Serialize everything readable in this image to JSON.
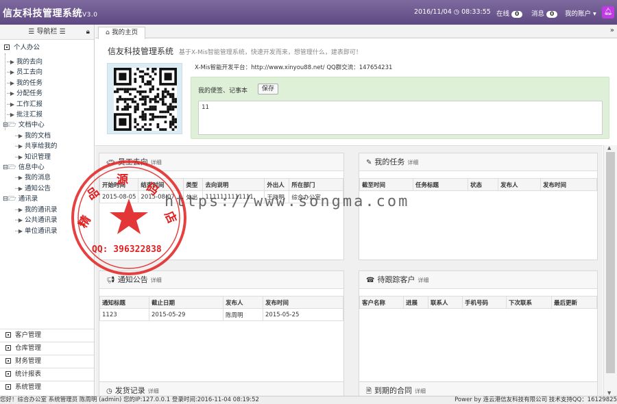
{
  "header": {
    "title": "信友科技管理系统",
    "version": "V3.0",
    "datetime": "2016/11/04",
    "time": "08:33:55",
    "online_label": "在线",
    "online_count": "0",
    "msg_label": "消息",
    "msg_count": "0",
    "account_label": "我的账户"
  },
  "sidebar": {
    "title": "导航栏",
    "top_group": "个人办公",
    "items": [
      "我的去向",
      "员工去向",
      "我的任务",
      "分配任务",
      "工作汇报",
      "批注汇报"
    ],
    "doc_group": "文档中心",
    "doc_items": [
      "我的文档",
      "共享给我的",
      "知识管理"
    ],
    "info_group": "信息中心",
    "info_items": [
      "我的消息",
      "通知公告"
    ],
    "contact_group": "通讯录",
    "contact_items": [
      "我的通讯录",
      "公共通讯录",
      "单位通讯录"
    ],
    "bottom": [
      "客户管理",
      "仓库管理",
      "财务管理",
      "统计报表",
      "系统管理"
    ]
  },
  "tabs": {
    "home": "我的主页"
  },
  "welcome": {
    "title": "信友科技管理系统",
    "subtitle": "基于X-Mis智能管理系统，快速开发而来，想管理什么，建表即可！",
    "dev_line": "X-Mis智能开发平台：http://www.xinyou88.net/ QQ群交流：147654231",
    "notebook_label": "我的便签、记事本",
    "save_label": "保存",
    "notebook_value": "11"
  },
  "panels": {
    "staff": {
      "title": "员工去向",
      "more": "详细",
      "columns": [
        "开始时间",
        "结束时间",
        "类型",
        "去向说明",
        "外出人",
        "所在部门"
      ],
      "rows": [
        [
          "2015-08-05",
          "2015-08-07",
          "外出",
          "1111111111111",
          "王晓明",
          "综合办公室"
        ]
      ]
    },
    "tasks": {
      "title": "我的任务",
      "more": "详细",
      "columns": [
        "截至时间",
        "任务标题",
        "状态",
        "发布人",
        "发布时间"
      ]
    },
    "notice": {
      "title": "通知公告",
      "more": "详细",
      "columns": [
        "通知标题",
        "截止日期",
        "发布人",
        "发布时间"
      ],
      "rows": [
        [
          "1123",
          "2015-05-29",
          "陈周明",
          "2015-05-25"
        ]
      ]
    },
    "customers": {
      "title": "待跟踪客户",
      "more": "详细",
      "columns": [
        "客户名称",
        "进展",
        "联系人",
        "手机号码",
        "下次联系",
        "最后更新"
      ]
    },
    "logs": {
      "title": "发货记录",
      "more": "详细"
    },
    "contracts": {
      "title": "到期的合同",
      "more": "详细"
    }
  },
  "footer": {
    "left": "您好！综合办公室 系统管理员 陈周明 (admin) 您的IP:127.0.0.1 登录时间:2016-11-04 08:19:52",
    "right": "Power by 连云港信友科技有限公司 技术支持QQ：16129825"
  },
  "watermark": {
    "url": "https://www.songma.com",
    "stamp_text": "精品源码店",
    "stamp_qq": "QQ: 396322838"
  },
  "colors": {
    "header": "#6a5690",
    "accent": "#c239e6",
    "note_bg": "#dff0d8",
    "stamp": "#e02020"
  }
}
